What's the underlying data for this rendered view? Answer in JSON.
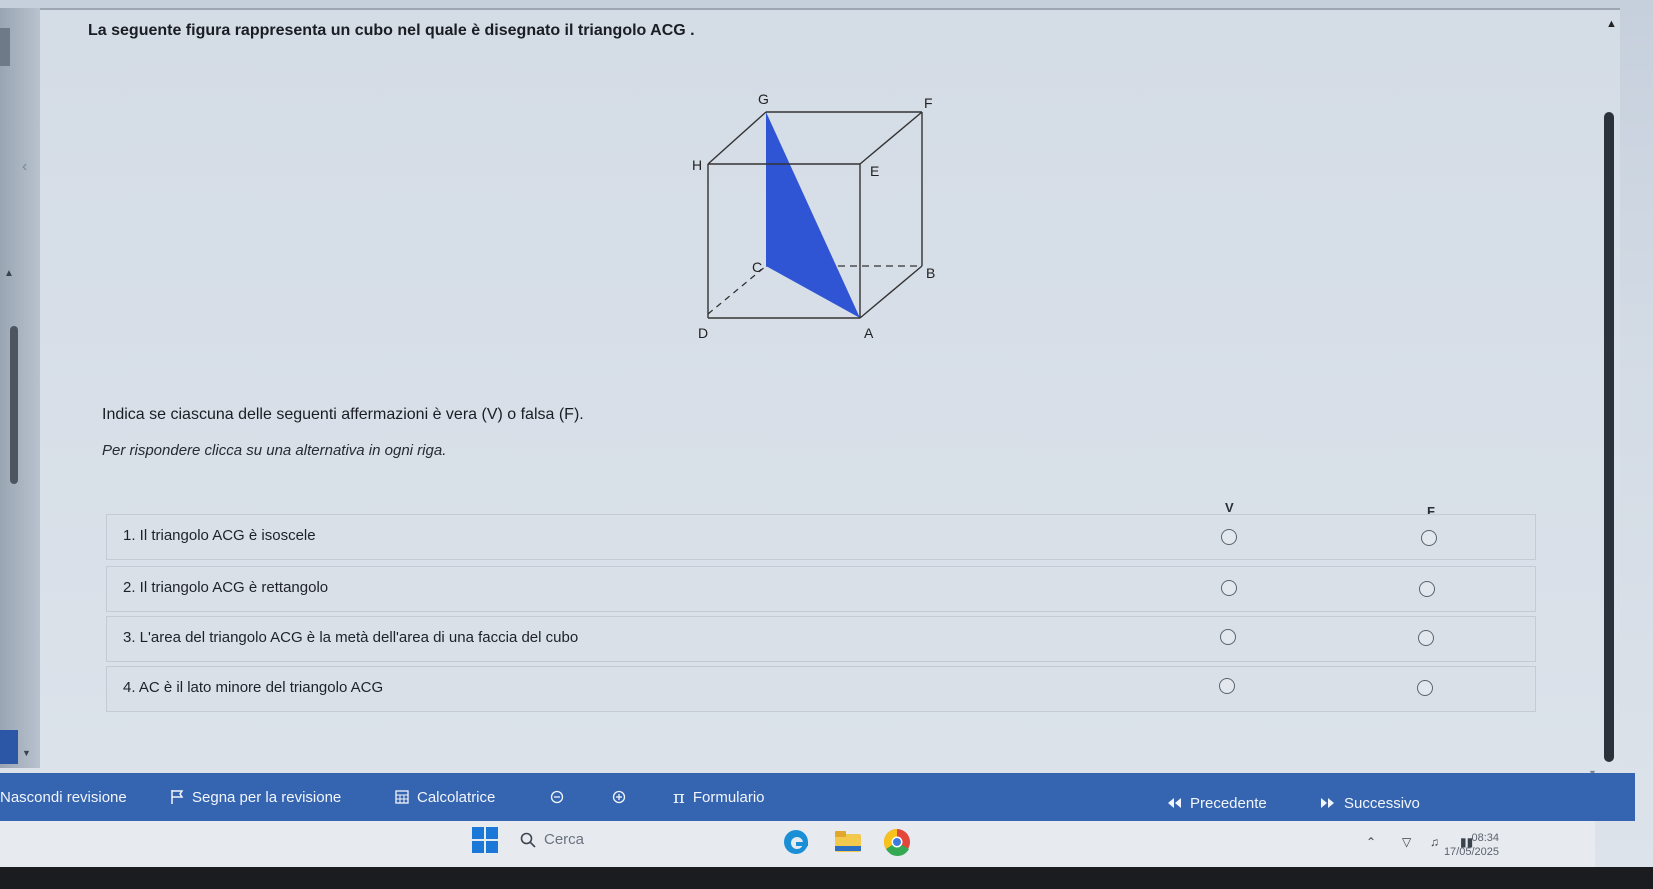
{
  "question": {
    "title": "La seguente figura rappresenta un cubo nel quale è disegnato il triangolo ACG .",
    "figure_labels": {
      "G": "G",
      "F": "F",
      "H": "H",
      "E": "E",
      "C": "C",
      "B": "B",
      "D": "D",
      "A": "A"
    },
    "triangle_color": "#2f55d4",
    "instruction": "Indica se ciascuna delle seguenti affermazioni è vera (V) o falsa (F).",
    "hint": "Per rispondere clicca su una alternativa in ogni riga.",
    "columns": {
      "v": "V",
      "f": "F"
    },
    "statements": [
      {
        "label": "1. Il triangolo ACG è isoscele"
      },
      {
        "label": "2. Il triangolo ACG è rettangolo"
      },
      {
        "label": "3. L'area del triangolo ACG è la metà dell'area di una faccia del cubo"
      },
      {
        "label": "4. AC è il lato minore del triangolo ACG"
      }
    ]
  },
  "navbar": {
    "hide_review": "Nascondi revisione",
    "mark_review": "Segna per la revisione",
    "calculator": "Calcolatrice",
    "formulary": "Formulario",
    "previous": "Precedente",
    "next": "Successivo",
    "color": "#3565b0"
  },
  "taskbar": {
    "search_placeholder": "Cerca",
    "time": "08:34",
    "date": "17/05/2025"
  }
}
